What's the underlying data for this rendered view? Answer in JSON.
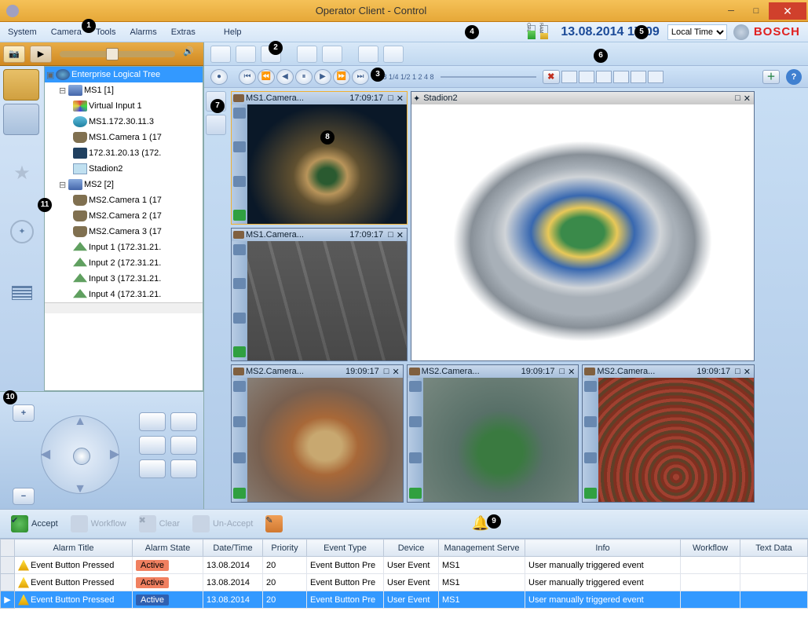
{
  "window": {
    "title": "Operator Client - Control"
  },
  "menu": {
    "system": "System",
    "camera": "Camera",
    "tools": "Tools",
    "alarms": "Alarms",
    "extras": "Extras",
    "help": "Help"
  },
  "status": {
    "datetime": "13.08.2014 17:09",
    "tz": "Local Time",
    "brand": "BOSCH"
  },
  "tree": {
    "root": "Enterprise Logical Tree",
    "ms1": {
      "label": "MS1 [1]",
      "virtual": "Virtual Input 1",
      "drive": "MS1.172.30.11.3",
      "cam1": "MS1.Camera 1 (17",
      "enc": "172.31.20.13 (172.",
      "map": "Stadion2"
    },
    "ms2": {
      "label": "MS2 [2]",
      "cam1": "MS2.Camera 1 (17",
      "cam2": "MS2.Camera 2 (17",
      "cam3": "MS2.Camera 3 (17",
      "in1": "Input 1 (172.31.21.",
      "in2": "Input 2 (172.31.21.",
      "in3": "Input 3 (172.31.21.",
      "in4": "Input 4 (172.31.21."
    }
  },
  "playback": {
    "speeds": "1/8 1/4 1/2   1    2    4    8"
  },
  "panes": {
    "p1": {
      "name": "MS1.Camera...",
      "time": "17:09:17"
    },
    "p2": {
      "name": "MS1.Camera...",
      "time": "17:09:17"
    },
    "big": {
      "name": "Stadion2"
    },
    "p3": {
      "name": "MS2.Camera...",
      "time": "19:09:17"
    },
    "p4": {
      "name": "MS2.Camera...",
      "time": "19:09:17"
    },
    "p5": {
      "name": "MS2.Camera...",
      "time": "19:09:17"
    }
  },
  "alarmBar": {
    "accept": "Accept",
    "workflow": "Workflow",
    "clear": "Clear",
    "unaccept": "Un-Accept"
  },
  "alarmTable": {
    "cols": {
      "title": "Alarm Title",
      "state": "Alarm State",
      "dt": "Date/Time",
      "prio": "Priority",
      "et": "Event Type",
      "dev": "Device",
      "ms": "Management Serve",
      "info": "Info",
      "wf": "Workflow",
      "td": "Text Data"
    },
    "rows": [
      {
        "title": "Event Button Pressed",
        "state": "Active",
        "dt": "13.08.2014",
        "prio": "20",
        "et": "Event Button Pre",
        "dev": "User Event",
        "ms": "MS1",
        "info": "User manually triggered event"
      },
      {
        "title": "Event Button Pressed",
        "state": "Active",
        "dt": "13.08.2014",
        "prio": "20",
        "et": "Event Button Pre",
        "dev": "User Event",
        "ms": "MS1",
        "info": "User manually triggered event"
      },
      {
        "title": "Event Button Pressed",
        "state": "Active",
        "dt": "13.08.2014",
        "prio": "20",
        "et": "Event Button Pre",
        "dev": "User Event",
        "ms": "MS1",
        "info": "User manually triggered event"
      }
    ]
  },
  "badges": {
    "b1": "1",
    "b2": "2",
    "b3": "3",
    "b4": "4",
    "b5": "5",
    "b6": "6",
    "b7": "7",
    "b8": "8",
    "b9": "9",
    "b10": "10",
    "b11": "11"
  }
}
